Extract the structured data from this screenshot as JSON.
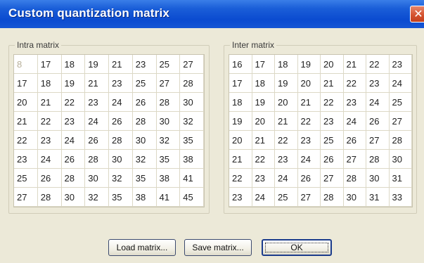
{
  "window": {
    "title": "Custom quantization matrix",
    "close_glyph": "✕"
  },
  "intra": {
    "label": "Intra matrix",
    "rows": [
      [
        "8",
        "17",
        "18",
        "19",
        "21",
        "23",
        "25",
        "27"
      ],
      [
        "17",
        "18",
        "19",
        "21",
        "23",
        "25",
        "27",
        "28"
      ],
      [
        "20",
        "21",
        "22",
        "23",
        "24",
        "26",
        "28",
        "30"
      ],
      [
        "21",
        "22",
        "23",
        "24",
        "26",
        "28",
        "30",
        "32"
      ],
      [
        "22",
        "23",
        "24",
        "26",
        "28",
        "30",
        "32",
        "35"
      ],
      [
        "23",
        "24",
        "26",
        "28",
        "30",
        "32",
        "35",
        "38"
      ],
      [
        "25",
        "26",
        "28",
        "30",
        "32",
        "35",
        "38",
        "41"
      ],
      [
        "27",
        "28",
        "30",
        "32",
        "35",
        "38",
        "41",
        "45"
      ]
    ]
  },
  "inter": {
    "label": "Inter matrix",
    "rows": [
      [
        "16",
        "17",
        "18",
        "19",
        "20",
        "21",
        "22",
        "23"
      ],
      [
        "17",
        "18",
        "19",
        "20",
        "21",
        "22",
        "23",
        "24"
      ],
      [
        "18",
        "19",
        "20",
        "21",
        "22",
        "23",
        "24",
        "25"
      ],
      [
        "19",
        "20",
        "21",
        "22",
        "23",
        "24",
        "26",
        "27"
      ],
      [
        "20",
        "21",
        "22",
        "23",
        "25",
        "26",
        "27",
        "28"
      ],
      [
        "21",
        "22",
        "23",
        "24",
        "26",
        "27",
        "28",
        "30"
      ],
      [
        "22",
        "23",
        "24",
        "26",
        "27",
        "28",
        "30",
        "31"
      ],
      [
        "23",
        "24",
        "25",
        "27",
        "28",
        "30",
        "31",
        "33"
      ]
    ]
  },
  "buttons": {
    "load": "Load matrix...",
    "save": "Save matrix...",
    "ok": "OK"
  }
}
